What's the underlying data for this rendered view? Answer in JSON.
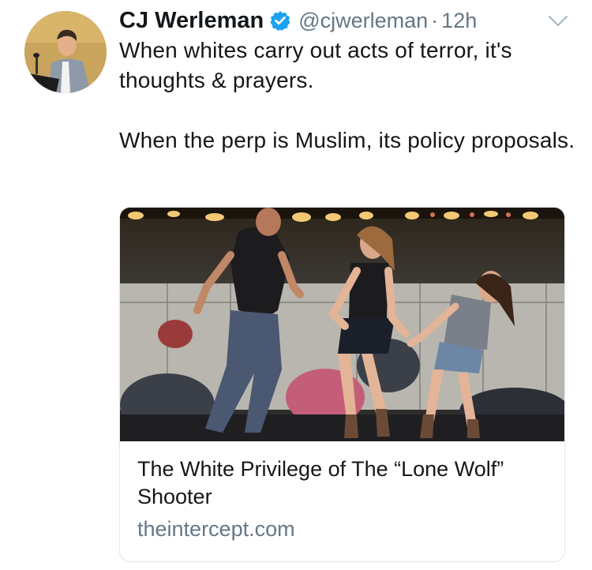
{
  "author": {
    "display_name": "CJ Werleman",
    "handle": "@cjwerleman",
    "separator": "·",
    "timestamp": "12h",
    "verified": true
  },
  "tweet": {
    "paragraphs": [
      "When whites carry out acts of terror, it's thoughts & prayers.",
      "When the perp is Muslim, its policy proposals."
    ]
  },
  "link_card": {
    "title": "The White Privilege of The “Lone Wolf” Shooter",
    "domain": "theintercept.com"
  },
  "icons": {
    "verified": "verified-badge-icon",
    "menu": "chevron-down-icon"
  },
  "colors": {
    "text_primary": "#14171a",
    "text_secondary": "#657786",
    "verified_blue": "#1da1f2",
    "card_border": "#e1e8ed"
  }
}
